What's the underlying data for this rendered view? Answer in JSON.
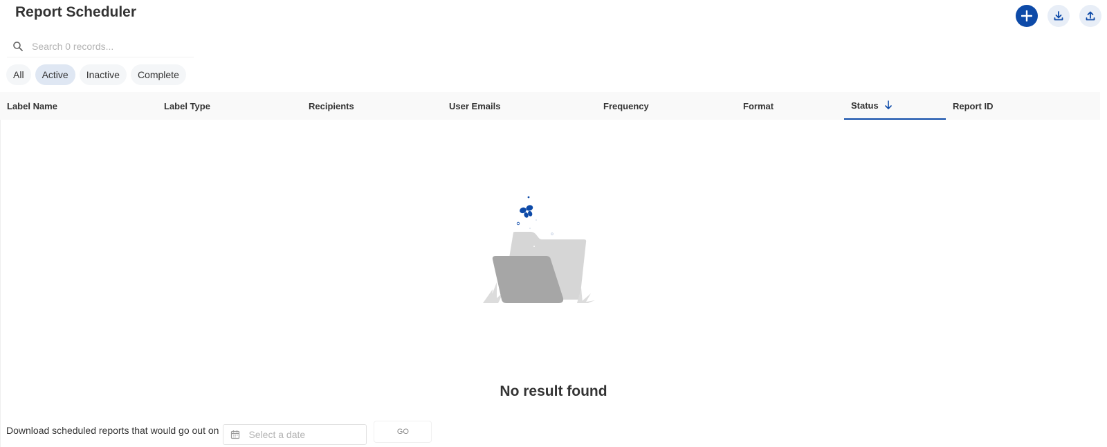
{
  "page": {
    "title": "Report Scheduler"
  },
  "toolbar": {
    "add_icon": "plus-icon",
    "download_icon": "download-icon",
    "upload_icon": "upload-icon"
  },
  "search": {
    "placeholder": "Search 0 records...",
    "value": ""
  },
  "filters": [
    {
      "label": "All",
      "selected": false
    },
    {
      "label": "Active",
      "selected": true
    },
    {
      "label": "Inactive",
      "selected": false
    },
    {
      "label": "Complete",
      "selected": false
    }
  ],
  "table": {
    "columns": [
      {
        "label": "Label Name"
      },
      {
        "label": "Label Type"
      },
      {
        "label": "Recipients"
      },
      {
        "label": "User Emails"
      },
      {
        "label": "Frequency"
      },
      {
        "label": "Format"
      },
      {
        "label": "Status",
        "sort": "descending"
      },
      {
        "label": "Report ID"
      }
    ],
    "rows": []
  },
  "empty_state": {
    "message": "No result found",
    "illustration": "empty-folder-icon"
  },
  "bottom": {
    "label": "Download scheduled reports that would go out on",
    "date_placeholder": "Select a date",
    "go_label": "GO",
    "calendar_icon": "calendar-icon"
  },
  "colors": {
    "accent": "#0d4aa8",
    "chip_active": "#dfe7f3",
    "header_bg": "#f9f9f9"
  }
}
